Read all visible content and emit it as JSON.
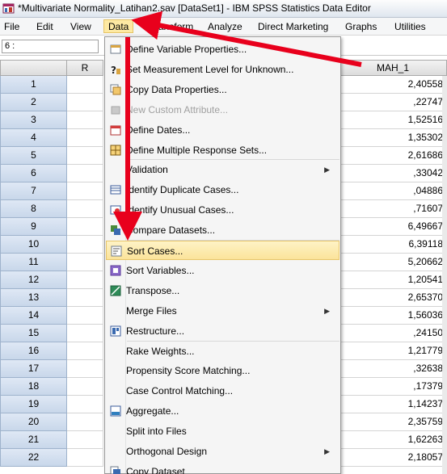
{
  "window": {
    "title": "*Multivariate Normality_Latihan2.sav [DataSet1] - IBM SPSS Statistics Data Editor",
    "app_icon": "spss-app-icon"
  },
  "menubar": {
    "file": "File",
    "edit": "Edit",
    "view": "View",
    "data": "Data",
    "transform": "Transform",
    "analyze": "Analyze",
    "direct_marketing": "Direct Marketing",
    "graphs": "Graphs",
    "utilities": "Utilities"
  },
  "cell_ref": {
    "value": "6 :"
  },
  "grid": {
    "col_a_header": "R",
    "col_b_header": "MAH_1",
    "rows": [
      {
        "num": "1",
        "value": "2,40558"
      },
      {
        "num": "2",
        "value": ",22747"
      },
      {
        "num": "3",
        "value": "1,52516"
      },
      {
        "num": "4",
        "value": "1,35302"
      },
      {
        "num": "5",
        "value": "2,61686"
      },
      {
        "num": "6",
        "value": ",33042"
      },
      {
        "num": "7",
        "value": ",04886"
      },
      {
        "num": "8",
        "value": ",71607"
      },
      {
        "num": "9",
        "value": "6,49667"
      },
      {
        "num": "10",
        "value": "6,39118"
      },
      {
        "num": "11",
        "value": "5,20662"
      },
      {
        "num": "12",
        "value": "1,20541"
      },
      {
        "num": "13",
        "value": "2,65370"
      },
      {
        "num": "14",
        "value": "1,56036"
      },
      {
        "num": "15",
        "value": ",24150"
      },
      {
        "num": "16",
        "value": "1,21779"
      },
      {
        "num": "17",
        "value": ",32638"
      },
      {
        "num": "18",
        "value": ",17379"
      },
      {
        "num": "19",
        "value": "1,14237"
      },
      {
        "num": "20",
        "value": "2,35759"
      },
      {
        "num": "21",
        "value": "1,62263"
      },
      {
        "num": "22",
        "value": "2,18057"
      }
    ]
  },
  "data_menu": {
    "items": [
      {
        "label": "Define Variable Properties...",
        "icon": "define-variable-properties-icon"
      },
      {
        "label": "Set Measurement Level for Unknown...",
        "icon": "measurement-level-icon"
      },
      {
        "label": "Copy Data Properties...",
        "icon": "copy-data-properties-icon"
      },
      {
        "label": "New Custom Attribute...",
        "icon": "custom-attribute-icon",
        "disabled": true
      },
      {
        "label": "Define Dates...",
        "icon": "calendar-icon"
      },
      {
        "label": "Define Multiple Response Sets...",
        "icon": "grid-sets-icon"
      },
      {
        "label": "Validation",
        "submenu": true
      },
      {
        "label": "Identify Duplicate Cases...",
        "icon": "duplicate-cases-icon"
      },
      {
        "label": "Identify Unusual Cases...",
        "icon": "unusual-cases-icon"
      },
      {
        "label": "Compare Datasets...",
        "icon": "compare-datasets-icon"
      },
      {
        "label": "Sort Cases...",
        "icon": "sort-cases-icon",
        "highlighted": true
      },
      {
        "label": "Sort Variables...",
        "icon": "sort-variables-icon"
      },
      {
        "label": "Transpose...",
        "icon": "transpose-icon"
      },
      {
        "label": "Merge Files",
        "submenu": true
      },
      {
        "label": "Restructure...",
        "icon": "restructure-icon"
      },
      {
        "label": "Rake Weights..."
      },
      {
        "label": "Propensity Score Matching..."
      },
      {
        "label": "Case Control Matching..."
      },
      {
        "label": "Aggregate...",
        "icon": "aggregate-icon"
      },
      {
        "label": "Split into Files"
      },
      {
        "label": "Orthogonal Design",
        "submenu": true
      },
      {
        "label": "Copy Dataset",
        "icon": "copy-dataset-icon"
      }
    ]
  },
  "colors": {
    "highlight": "#fbe39a",
    "arrow": "#e8001c",
    "row_header": "#c8d7ea"
  }
}
